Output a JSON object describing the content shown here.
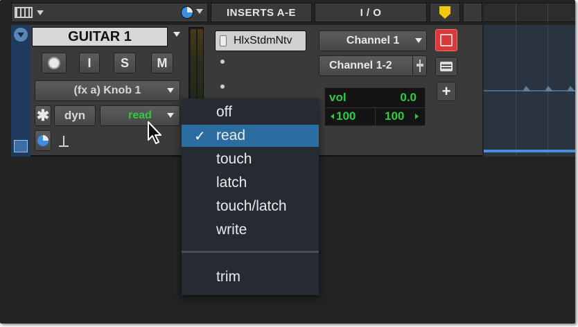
{
  "header": {
    "inserts_label": "INSERTS A-E",
    "io_label": "I / O"
  },
  "track": {
    "name": "GUITAR 1",
    "buttons": {
      "record": "",
      "input": "I",
      "solo": "S",
      "mute": "M"
    },
    "automation_target": "(fx a) Knob 1",
    "dyn_label": "dyn",
    "automation_mode": "read"
  },
  "inserts": {
    "slot1": "HlxStdmNtv"
  },
  "io": {
    "input": "Channel 1",
    "output": "Channel 1-2",
    "vol_label": "vol",
    "vol_value": "0.0",
    "pan_left": "100",
    "pan_right": "100"
  },
  "menu": {
    "items": [
      "off",
      "read",
      "touch",
      "latch",
      "touch/latch",
      "write"
    ],
    "selected": "read",
    "extra": "trim"
  },
  "colors": {
    "menu_bg": "#262b33",
    "selected_bg": "#2c6da1",
    "accent_green": "#2ecc40",
    "record_red": "#e8474a",
    "marker_yellow": "#f2c811"
  }
}
